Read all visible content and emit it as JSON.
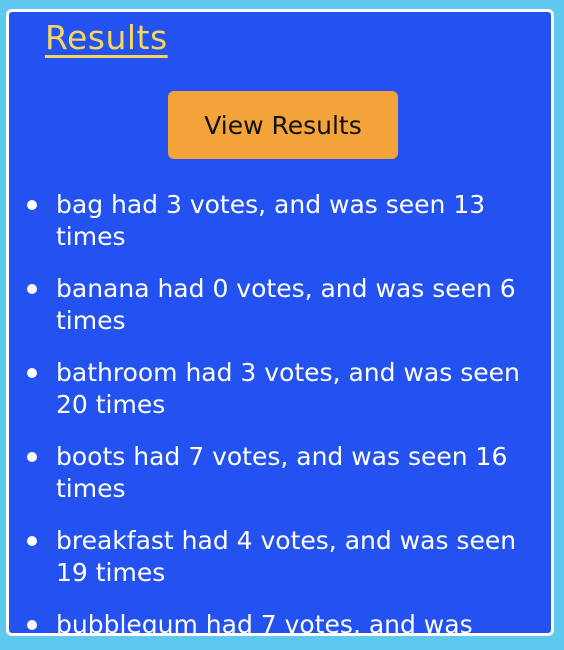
{
  "header": {
    "title": "Results"
  },
  "toolbar": {
    "view_results_label": "View Results"
  },
  "results": {
    "items": [
      "bag had 3 votes, and was seen 13 times",
      "banana had 0 votes, and was seen 6 times",
      "bathroom had 3 votes, and was seen 20 times",
      "boots had 7 votes, and was seen 16 times",
      "breakfast had 4 votes, and was seen 19 times",
      "bubblegum had 7 votes, and was"
    ]
  },
  "colors": {
    "background": "#5fc8ee",
    "panel": "#2352f0",
    "title": "#f5d75e",
    "button": "#f4a23a",
    "text": "#ffffff"
  }
}
